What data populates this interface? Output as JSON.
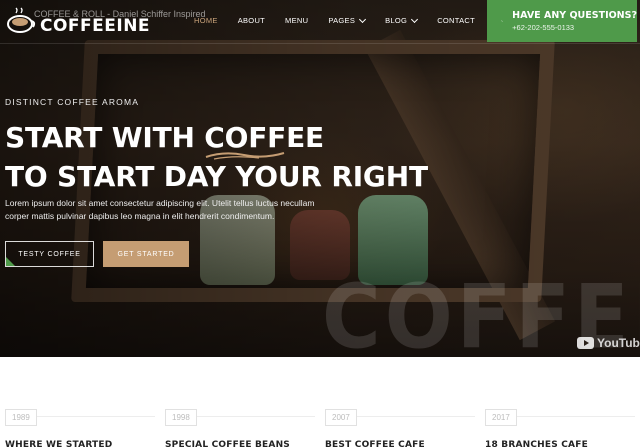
{
  "video": {
    "title": "COFFEE & ROLL - Daniel Schiffer Inspired",
    "watermark": "COFFEEIN",
    "youtube_label": "YouTube"
  },
  "brand": {
    "name": "COFFEEINE",
    "icon": "coffee-cup-icon"
  },
  "nav": {
    "items": [
      {
        "label": "HOME",
        "active": true,
        "dropdown": false
      },
      {
        "label": "ABOUT",
        "active": false,
        "dropdown": false
      },
      {
        "label": "MENU",
        "active": false,
        "dropdown": false
      },
      {
        "label": "PAGES",
        "active": false,
        "dropdown": true
      },
      {
        "label": "BLOG",
        "active": false,
        "dropdown": true
      },
      {
        "label": "CONTACT",
        "active": false,
        "dropdown": false
      }
    ]
  },
  "contact_box": {
    "title": "HAVE ANY QUESTIONS?",
    "phone": "+62-202-555-0133",
    "icon": "phone-icon"
  },
  "hero": {
    "kicker": "DISTINCT COFFEE AROMA",
    "headline_line1_prefix": "START WITH ",
    "headline_line1_highlight": "COFFEE",
    "headline_line2": "TO START DAY YOUR RIGHT",
    "lead": "Lorem ipsum dolor sit amet consectetur adipiscing elit. Utelit tellus luctus necullam corper mattis pulvinar dapibus leo magna in elit hendrerit condimentum.",
    "btn_secondary": "TESTY COFFEE",
    "btn_primary": "GET STARTED"
  },
  "timeline": {
    "items": [
      {
        "year": "1989",
        "title": "WHERE WE STARTED"
      },
      {
        "year": "1998",
        "title": "SPECIAL COFFEE BEANS"
      },
      {
        "year": "2007",
        "title": "BEST COFFEE CAFE"
      },
      {
        "year": "2017",
        "title": "18 BRANCHES CAFE"
      }
    ]
  },
  "colors": {
    "accent_green": "#4f9a4a",
    "accent_tan": "#c59d73",
    "nav_active": "#c9a37a"
  }
}
